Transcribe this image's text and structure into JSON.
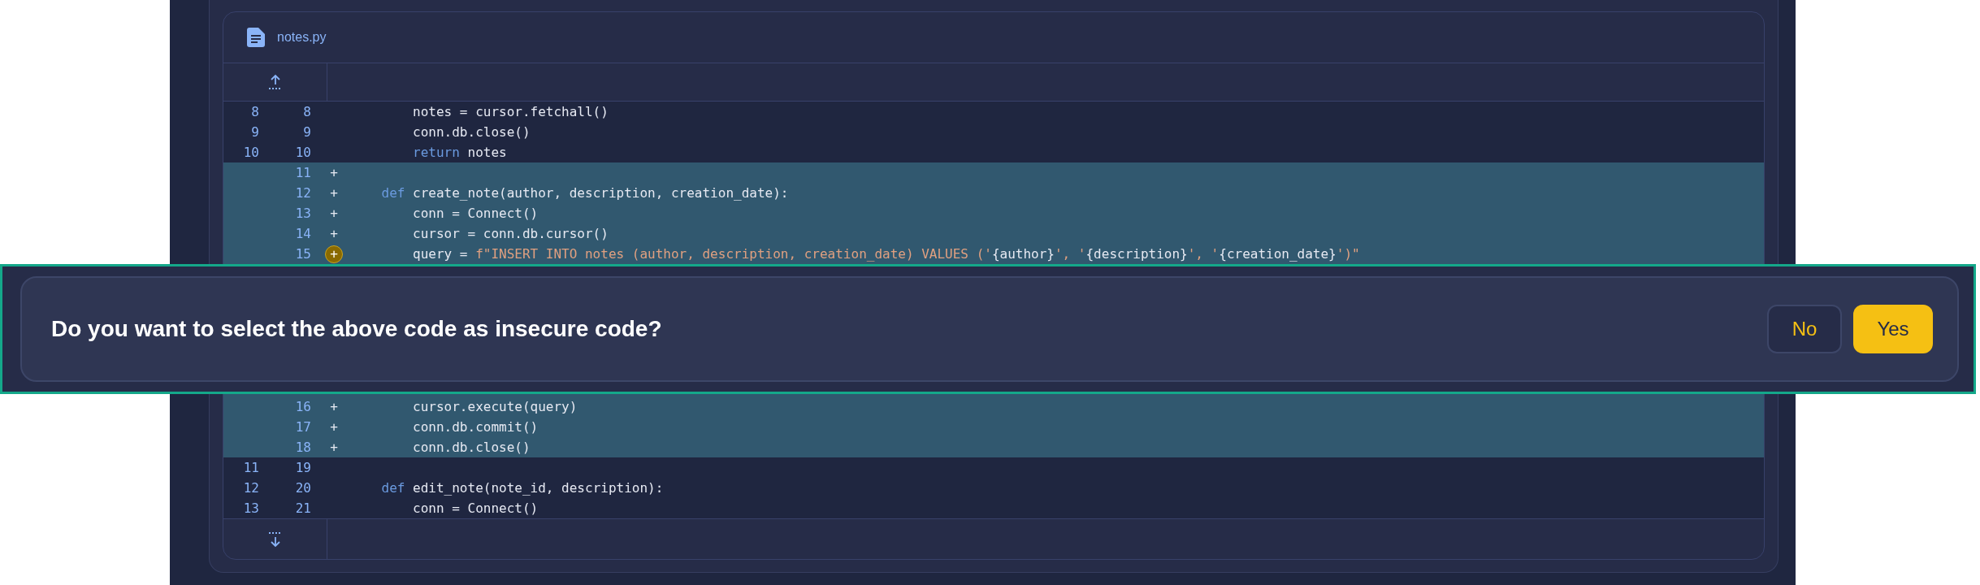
{
  "file": {
    "name": "notes.py"
  },
  "rows": [
    {
      "kind": "context",
      "old": "8",
      "new": "8",
      "tokens": [
        {
          "kind": "plain",
          "text": "        notes = cursor.fetchall()"
        }
      ]
    },
    {
      "kind": "context",
      "old": "9",
      "new": "9",
      "tokens": [
        {
          "kind": "plain",
          "text": "        conn.db.close()"
        }
      ]
    },
    {
      "kind": "context",
      "old": "10",
      "new": "10",
      "tokens": [
        {
          "kind": "keyword",
          "text": "        return"
        },
        {
          "kind": "plain",
          "text": " notes"
        }
      ]
    },
    {
      "kind": "added",
      "new": "11",
      "marker": "+",
      "highlighted": false,
      "tokens": []
    },
    {
      "kind": "added",
      "new": "12",
      "marker": "+",
      "highlighted": false,
      "tokens": [
        {
          "kind": "keyword",
          "text": "    def"
        },
        {
          "kind": "plain",
          "text": " create_note(author, description, creation_date):"
        }
      ]
    },
    {
      "kind": "added",
      "new": "13",
      "marker": "+",
      "highlighted": false,
      "tokens": [
        {
          "kind": "plain",
          "text": "        conn = Connect()"
        }
      ]
    },
    {
      "kind": "added",
      "new": "14",
      "marker": "+",
      "highlighted": false,
      "tokens": [
        {
          "kind": "plain",
          "text": "        cursor = conn.db.cursor()"
        }
      ]
    },
    {
      "kind": "added",
      "new": "15",
      "marker": "+",
      "highlighted": true,
      "tokens": [
        {
          "kind": "plain",
          "text": "        query = "
        },
        {
          "kind": "string",
          "text": "f\"INSERT INTO notes (author, description, creation_date) VALUES ('"
        },
        {
          "kind": "plain",
          "text": "{author}"
        },
        {
          "kind": "string",
          "text": "', '"
        },
        {
          "kind": "plain",
          "text": "{description}"
        },
        {
          "kind": "string",
          "text": "', '"
        },
        {
          "kind": "plain",
          "text": "{creation_date}"
        },
        {
          "kind": "string",
          "text": "')\""
        }
      ]
    },
    {
      "kind": "gap"
    },
    {
      "kind": "added",
      "new": "16",
      "marker": "+",
      "highlighted": false,
      "tokens": [
        {
          "kind": "plain",
          "text": "        cursor.execute(query)"
        }
      ]
    },
    {
      "kind": "added",
      "new": "17",
      "marker": "+",
      "highlighted": false,
      "tokens": [
        {
          "kind": "plain",
          "text": "        conn.db.commit()"
        }
      ]
    },
    {
      "kind": "added",
      "new": "18",
      "marker": "+",
      "highlighted": false,
      "tokens": [
        {
          "kind": "plain",
          "text": "        conn.db.close()"
        }
      ]
    },
    {
      "kind": "context",
      "old": "11",
      "new": "19",
      "tokens": []
    },
    {
      "kind": "context",
      "old": "12",
      "new": "20",
      "tokens": [
        {
          "kind": "keyword",
          "text": "    def"
        },
        {
          "kind": "plain",
          "text": " edit_note(note_id, description):"
        }
      ]
    },
    {
      "kind": "context",
      "old": "13",
      "new": "21",
      "tokens": [
        {
          "kind": "plain",
          "text": "        conn = Connect()"
        }
      ]
    }
  ],
  "prompt": {
    "question": "Do you want to select the above code as insecure code?",
    "buttons": [
      {
        "label": "No",
        "kind": "secondary"
      },
      {
        "label": "Yes",
        "kind": "primary"
      }
    ]
  }
}
